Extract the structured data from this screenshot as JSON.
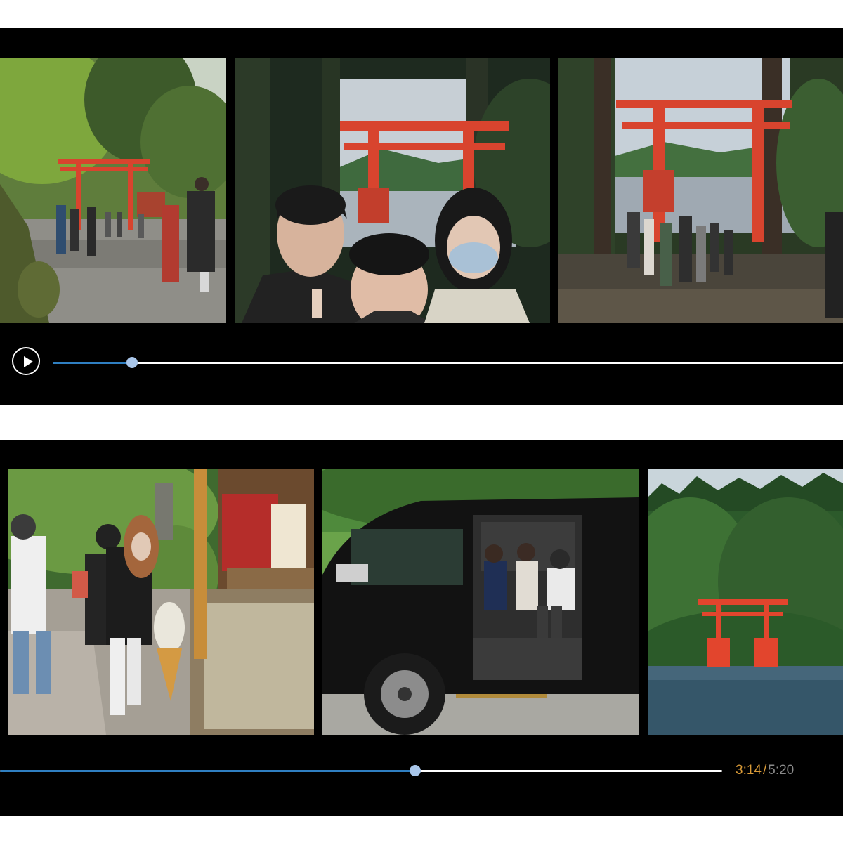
{
  "players": [
    {
      "id": "top",
      "progress": 0.1,
      "play_icon": "play-icon",
      "thumbnails": [
        {
          "scene": "torii-gate-forest-path"
        },
        {
          "scene": "selfie-kids-torii-lake"
        },
        {
          "scene": "crowd-torii-lakeside"
        }
      ]
    },
    {
      "id": "bottom",
      "progress": 0.575,
      "time": {
        "current": "3:14",
        "separator": "/",
        "total": "5:20"
      },
      "thumbnails": [
        {
          "scene": "ice-cream-shop-people"
        },
        {
          "scene": "black-van-passengers"
        },
        {
          "scene": "torii-in-lake"
        }
      ]
    }
  ],
  "colors": {
    "background": "#000000",
    "progress_fill": "#2f7fc1",
    "progress_track": "#ffffff",
    "knob": "#a9c6ea",
    "time_current": "#d99a37",
    "time_total": "#8a8a8a",
    "torii": "#d8442e"
  }
}
